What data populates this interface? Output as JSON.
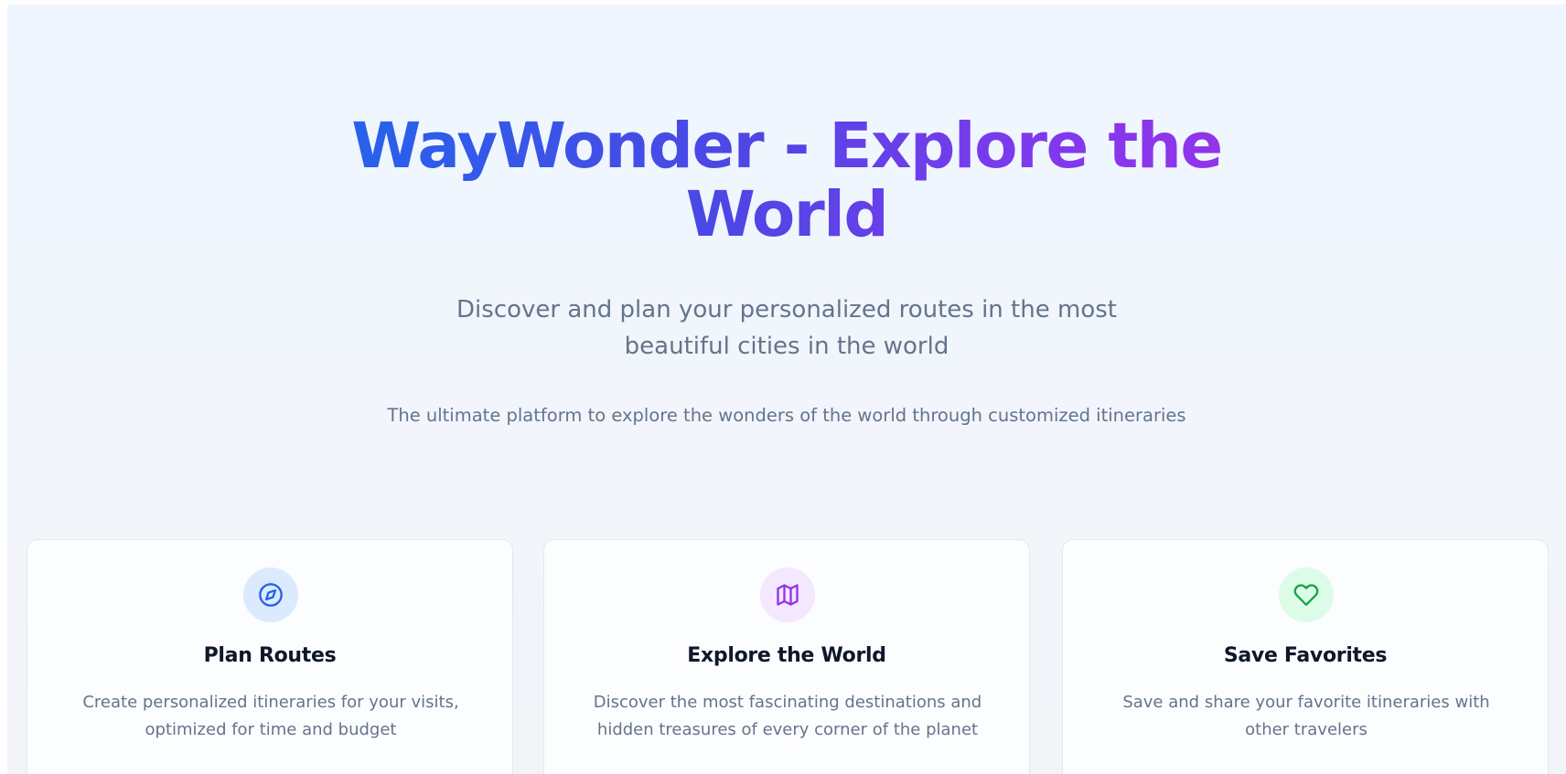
{
  "hero": {
    "title": "WayWonder - Explore the World",
    "subtitle": "Discover and plan your personalized routes in the most beautiful cities in the world",
    "tagline": "The ultimate platform to explore the wonders of the world through customized itineraries"
  },
  "features": [
    {
      "icon": "compass-icon",
      "color": "#2563eb",
      "title": "Plan Routes",
      "description": "Create personalized itineraries for your visits, optimized for time and budget"
    },
    {
      "icon": "map-icon",
      "color": "#9333ea",
      "title": "Explore the World",
      "description": "Discover the most fascinating destinations and hidden treasures of every corner of the planet"
    },
    {
      "icon": "heart-icon",
      "color": "#16a34a",
      "title": "Save Favorites",
      "description": "Save and share your favorite itineraries with other travelers"
    }
  ],
  "colors": {
    "gradient_start": "#2563eb",
    "gradient_end": "#9333ea",
    "muted_text": "#64748b"
  }
}
